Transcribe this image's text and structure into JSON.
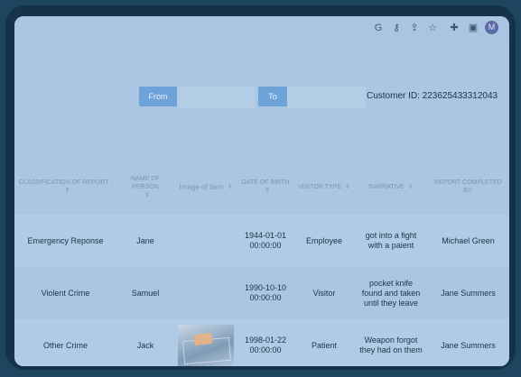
{
  "toolbar": {
    "icons": [
      "google-icon",
      "key-icon",
      "share-icon",
      "star-icon",
      "extensions-icon",
      "sidepanel-icon"
    ],
    "avatar_initial": "M"
  },
  "filters": {
    "from_label": "From",
    "to_label": "To",
    "from_value": "",
    "to_value": ""
  },
  "customer": {
    "text": "Customer ID: 223625433312043"
  },
  "table": {
    "headers": [
      "CLASSIFICATION OF REPORT :",
      "NAME OF PERSON",
      "Image of Item",
      "DATE OF BIRTH",
      "VISITOR TYPE",
      "NARRATIVE",
      "REPORT COMPLETED BY:"
    ],
    "rows": [
      {
        "classification": "Emergency Reponse",
        "name": "Jane",
        "image": "",
        "dob": "1944-01-01 00:00:00",
        "visitor_type": "Employee",
        "narrative": "got into a fight with a paient",
        "completed_by": "Michael Green"
      },
      {
        "classification": "Violent Crime",
        "name": "Samuel",
        "image": "",
        "dob": "1990-10-10 00:00:00",
        "visitor_type": "Visitor",
        "narrative": "pocket knife found and taken until they leave",
        "completed_by": "Jane Summers"
      },
      {
        "classification": "Other Crime",
        "name": "Jack",
        "image": "knife-in-bag-photo",
        "dob": "1998-01-22 00:00:00",
        "visitor_type": "Patient",
        "narrative": "Weapon forgot they had on them",
        "completed_by": "Jane Summers"
      }
    ]
  }
}
